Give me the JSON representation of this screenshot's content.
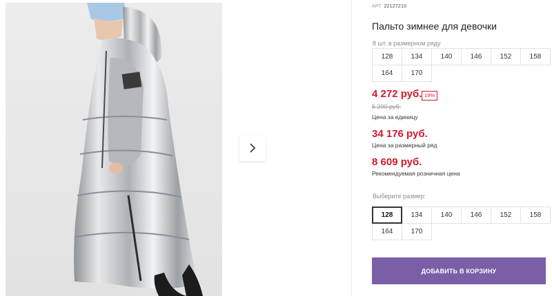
{
  "product": {
    "sku_label": "АРТ.",
    "sku_value": "22127210",
    "title": "Пальто зимнее для девочки",
    "row_note": "8 шт. в размерном ряду",
    "row_sizes": [
      "128",
      "134",
      "140",
      "146",
      "152",
      "158",
      "164",
      "170"
    ],
    "price_unit": "4 272 руб.",
    "discount_badge": "19%",
    "old_price": "5 290 руб.",
    "price_unit_label": "Цена за единицу",
    "price_row": "34 176 руб.",
    "price_row_label": "Цена за размерный ряд",
    "price_retail": "8 609 руб.",
    "price_retail_label": "Рекомендуемая розничная цена",
    "choose_label": "Выберите размер:",
    "select_sizes": [
      "128",
      "134",
      "140",
      "146",
      "152",
      "158",
      "164",
      "170"
    ],
    "selected_size": "128",
    "add_button": "ДОБАВИТЬ В КОРЗИНУ"
  },
  "colors": {
    "accent": "#7a5fa7",
    "price_red": "#d0192d",
    "coat_silver": "#c7c9cc"
  },
  "icons": {
    "next": "chevron-right-icon"
  }
}
